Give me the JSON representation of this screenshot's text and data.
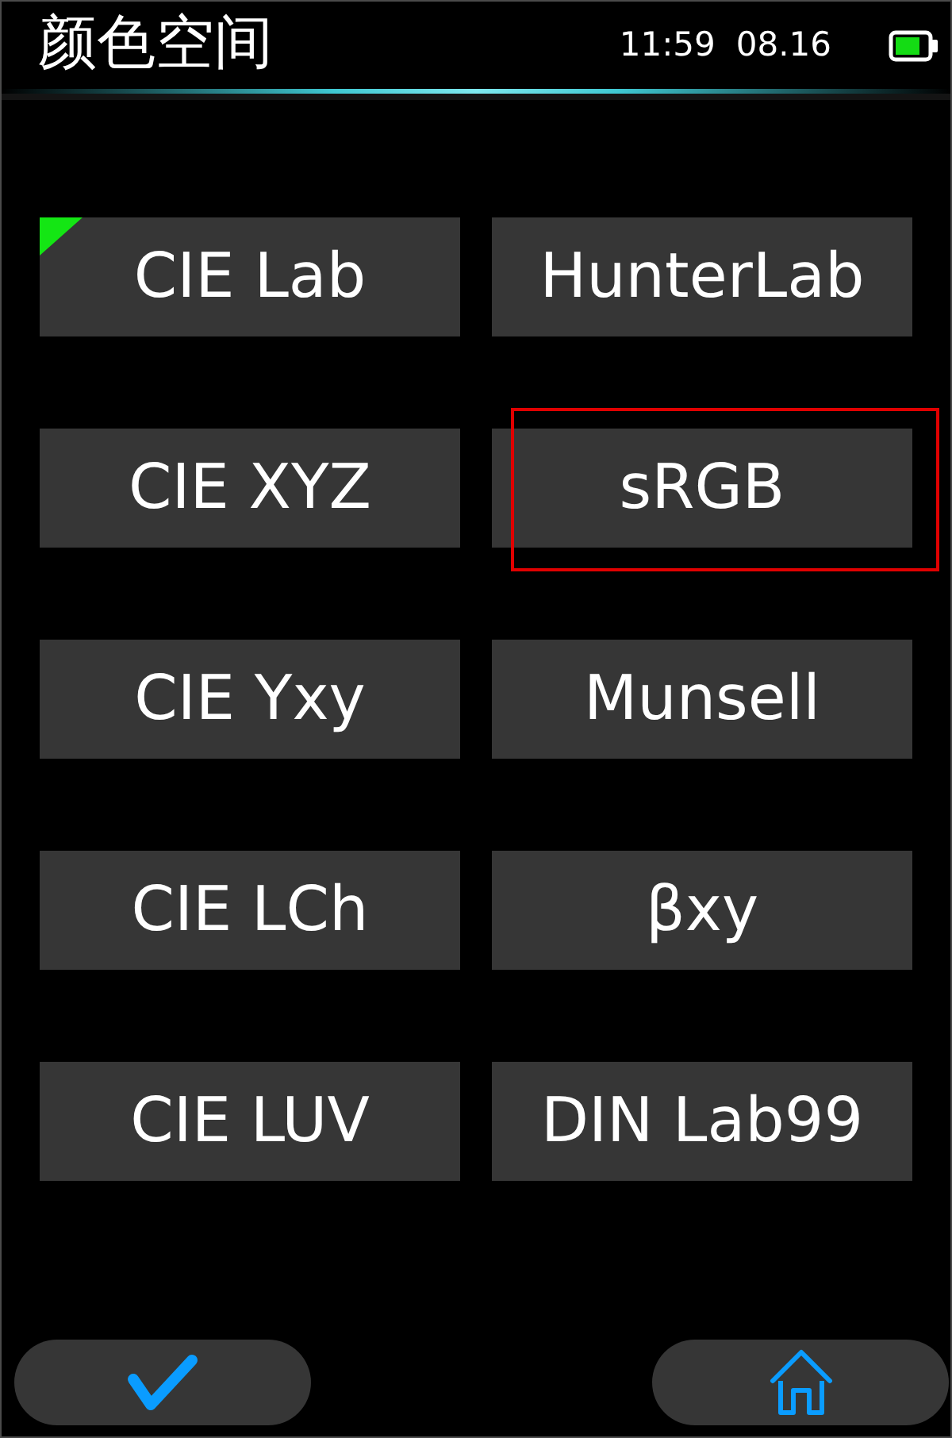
{
  "status_bar": {
    "title": "颜色空间",
    "time": "11:59",
    "date": "08.16"
  },
  "options": [
    {
      "label": "CIE Lab",
      "active": true,
      "selected": false
    },
    {
      "label": "HunterLab",
      "active": false,
      "selected": false
    },
    {
      "label": "CIE XYZ",
      "active": false,
      "selected": false
    },
    {
      "label": "sRGB",
      "active": false,
      "selected": true
    },
    {
      "label": "CIE Yxy",
      "active": false,
      "selected": false
    },
    {
      "label": "Munsell",
      "active": false,
      "selected": false
    },
    {
      "label": "CIE LCh",
      "active": false,
      "selected": false
    },
    {
      "label": "βxy",
      "active": false,
      "selected": false
    },
    {
      "label": "CIE LUV",
      "active": false,
      "selected": false
    },
    {
      "label": "DIN Lab99",
      "active": false,
      "selected": false
    }
  ]
}
